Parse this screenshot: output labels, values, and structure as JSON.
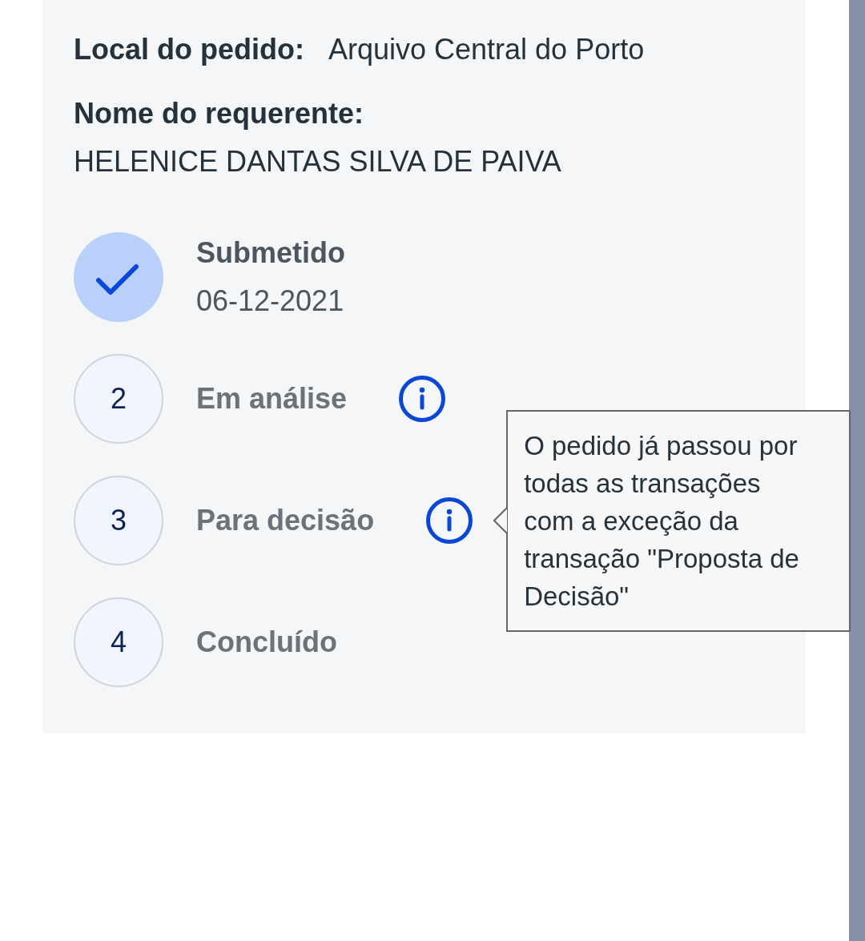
{
  "request": {
    "location_label": "Local do pedido:",
    "location": "Arquivo Central do Porto",
    "requester_label": "Nome do requerente:",
    "requester": "HELENICE DANTAS SILVA DE PAIVA"
  },
  "steps": [
    {
      "title": "Submetido",
      "date": "06-12-2021",
      "completed": true,
      "info": false
    },
    {
      "number": "2",
      "title": "Em análise",
      "completed": false,
      "info": true
    },
    {
      "number": "3",
      "title": "Para decisão",
      "completed": false,
      "info": true,
      "tooltip": "O pedido já passou por todas as transações com a exceção da transação \"Proposta de Decisão\""
    },
    {
      "number": "4",
      "title": "Concluído",
      "completed": false,
      "info": false
    }
  ]
}
